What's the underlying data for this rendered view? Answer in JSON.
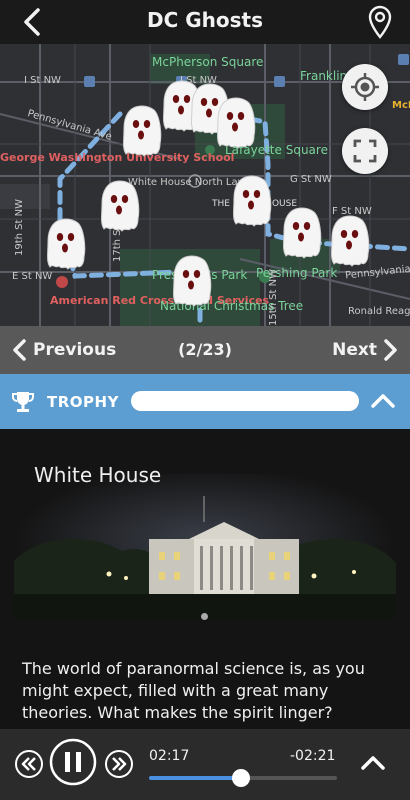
{
  "header": {
    "title": "DC Ghosts",
    "back_icon": "chevron-left-icon",
    "pin_icon": "map-pin-icon"
  },
  "map": {
    "labels": {
      "mcpherson": "McPherson Square",
      "franklin": "Franklin",
      "mcd": "McD",
      "i_st_1": "I St NW",
      "i_st_2": "I St NW",
      "penn": "Pennsylvania Ave",
      "lafayette": "Lafayette Square",
      "gwu": "George Washington University School",
      "g_st": "G St NW",
      "f_st": "F St NW",
      "south_lawn": "White House North Lawn",
      "white_house": "THE WHITE HOUSE",
      "st19": "19th St NW",
      "st17": "17th St NW",
      "e_st": "E St NW",
      "pres_park": "President's Park",
      "pershing": "Pershing Park",
      "penn2": "Pennsylvania Ave",
      "red_cross": "American Red Cross Blood Services",
      "xmas_tree": "National Christmas Tree",
      "st15": "15th St NW",
      "ronald": "Ronald Reagan Building and"
    }
  },
  "nav": {
    "prev_label": "Previous",
    "next_label": "Next",
    "count": "(2/23)"
  },
  "trophy": {
    "label": "TROPHY",
    "progress": 0.0
  },
  "content": {
    "place_name": "White House",
    "description": "The world of paranormal science is, as you might expect, filled with a great many theories.  What makes the spirit linger?"
  },
  "player": {
    "elapsed": "02:17",
    "remaining": "-02:21",
    "progress": 0.49
  },
  "colors": {
    "accent": "#5d9ed2",
    "route": "#7fb0e0",
    "slider": "#4a8fe0"
  }
}
